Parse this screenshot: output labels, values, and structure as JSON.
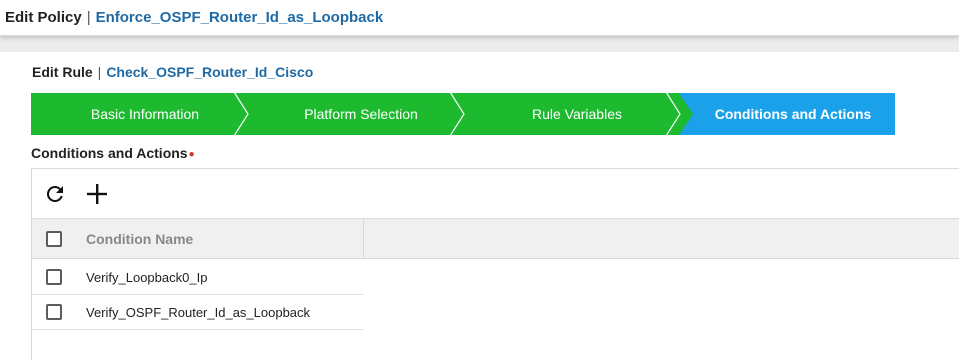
{
  "header": {
    "title": "Edit Policy",
    "separator": "|",
    "policy_name": "Enforce_OSPF_Router_Id_as_Loopback"
  },
  "rule": {
    "title": "Edit Rule",
    "separator": "|",
    "rule_name": "Check_OSPF_Router_Id_Cisco"
  },
  "wizard": {
    "steps": [
      {
        "label": "Basic Information",
        "state": "completed"
      },
      {
        "label": "Platform Selection",
        "state": "completed"
      },
      {
        "label": "Rule Variables",
        "state": "completed"
      },
      {
        "label": "Conditions and Actions",
        "state": "active"
      }
    ],
    "colors": {
      "completed": "#1db92f",
      "active": "#1aa1ea"
    }
  },
  "conditions": {
    "section_title": "Conditions and Actions",
    "required_marker": "●",
    "toolbar": {
      "refresh_icon": "refresh-icon",
      "add_icon": "plus-icon"
    },
    "columns": [
      "Condition Name"
    ],
    "rows": [
      {
        "name": "Verify_Loopback0_Ip",
        "checked": false
      },
      {
        "name": "Verify_OSPF_Router_Id_as_Loopback",
        "checked": false
      }
    ]
  }
}
